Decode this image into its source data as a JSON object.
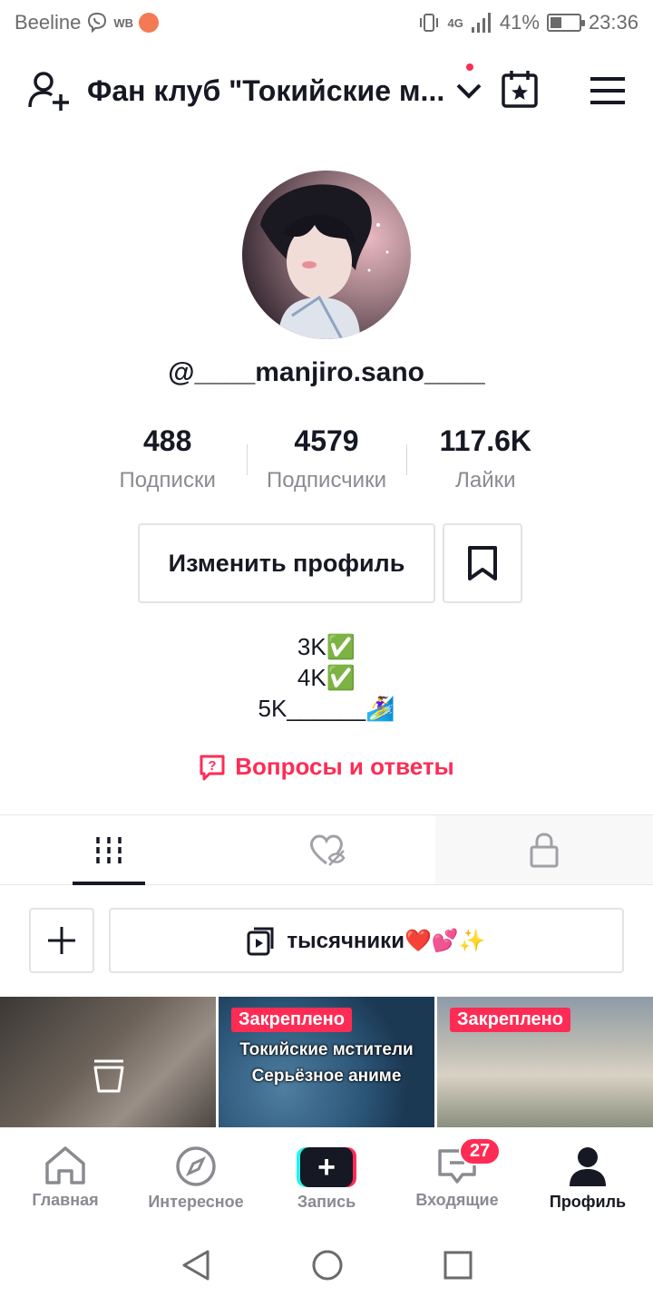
{
  "status_bar": {
    "carrier": "Beeline",
    "app_badge": "WB",
    "network": "4G",
    "battery": "41%",
    "battery_level": 0.41,
    "time": "23:36"
  },
  "header": {
    "title": "Фан клуб \"Токийские м...",
    "icons": [
      "add-user-icon",
      "chevron-down-icon",
      "calendar-icon",
      "menu-icon"
    ]
  },
  "profile": {
    "username": "@____manjiro.sano____",
    "stats": [
      {
        "value": "488",
        "label": "Подписки"
      },
      {
        "value": "4579",
        "label": "Подписчики"
      },
      {
        "value": "117.6K",
        "label": "Лайки"
      }
    ],
    "edit_button": "Изменить профиль",
    "bio_lines": [
      "3K✅",
      "4K✅",
      "5K______🏄‍♀️"
    ],
    "qa_link": "Вопросы и ответы"
  },
  "tabs": [
    "videos-tab",
    "liked-tab",
    "private-tab"
  ],
  "playlist": {
    "label": "тысячники❤️💕✨"
  },
  "videos": [
    {
      "pinned": "",
      "caption": ""
    },
    {
      "pinned": "Закреплено",
      "caption_lines": [
        "Токийские мстители",
        "Серьёзное аниме"
      ]
    },
    {
      "pinned": "Закреплено",
      "caption": ""
    }
  ],
  "bottom_nav": [
    {
      "label": "Главная",
      "icon": "home-icon"
    },
    {
      "label": "Интересное",
      "icon": "compass-icon"
    },
    {
      "label": "Запись",
      "icon": "create-icon"
    },
    {
      "label": "Входящие",
      "icon": "inbox-icon"
    },
    {
      "label": "Профиль",
      "icon": "profile-icon"
    }
  ],
  "inbox_badge": "27",
  "colors": {
    "accent": "#fe2c55",
    "text": "#161823",
    "muted": "#8a8b91",
    "border": "#e3e3e4"
  }
}
